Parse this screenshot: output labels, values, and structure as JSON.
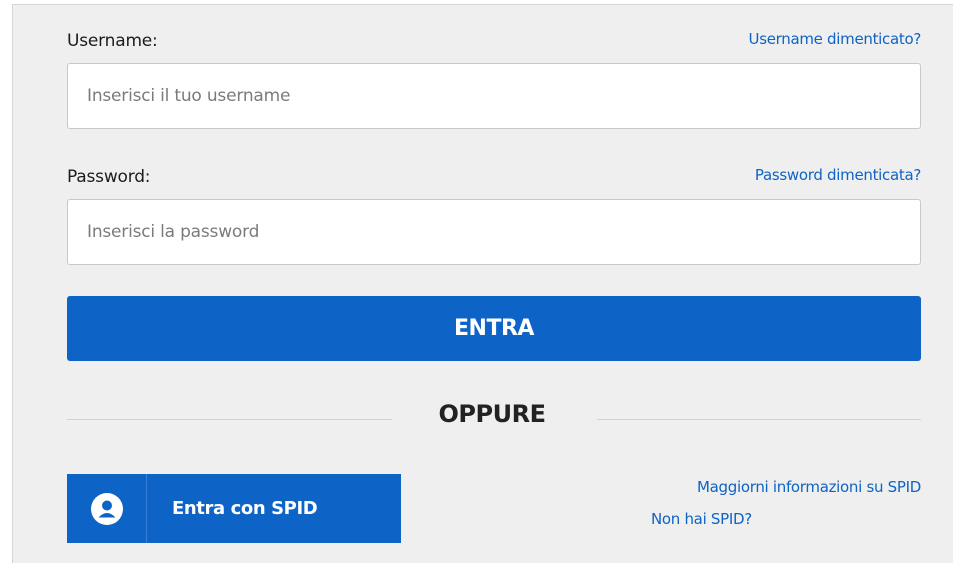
{
  "username": {
    "label": "Username:",
    "forgot_link": "Username dimenticato?",
    "placeholder": "Inserisci il tuo username",
    "value": ""
  },
  "password": {
    "label": "Password:",
    "forgot_link": "Password dimenticata?",
    "placeholder": "Inserisci la password",
    "value": ""
  },
  "submit": {
    "label": "ENTRA"
  },
  "divider": {
    "text": "OPPURE"
  },
  "spid": {
    "button_label": "Entra con SPID",
    "icon": "user-icon",
    "info_link": "Maggiorni informazioni su SPID",
    "no_spid_link": "Non hai SPID?"
  },
  "colors": {
    "primary": "#0e63c7",
    "panel_background": "#efefef",
    "link": "#0e63c7"
  }
}
